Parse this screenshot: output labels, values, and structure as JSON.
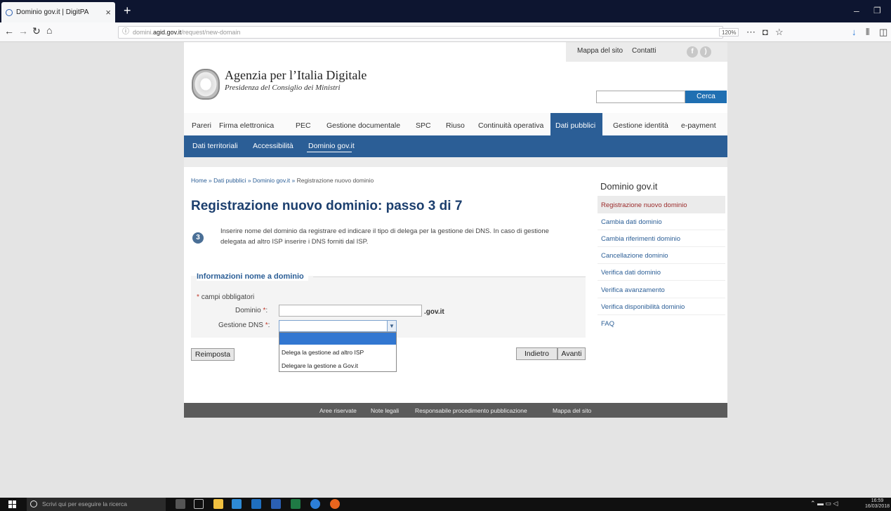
{
  "browser": {
    "tab_title": "Dominio gov.it | DigitPA",
    "url_prefix": "domini.",
    "url_host": "agid.gov.it",
    "url_path": "/request/new-domain",
    "zoom": "120%"
  },
  "header": {
    "sitemap": "Mappa del sito",
    "contacts": "Contatti",
    "agency": "Agenzia per l’Italia Digitale",
    "presidency": "Presidenza del Consiglio dei Ministri",
    "search_button": "Cerca"
  },
  "main_nav": [
    "Pareri",
    "Firma elettronica",
    "PEC",
    "Gestione documentale",
    "SPC",
    "Riuso",
    "Continuità operativa",
    "Dati pubblici",
    "Gestione identità",
    "e-payment"
  ],
  "sub_nav": [
    "Dati territoriali",
    "Accessibilità",
    "Dominio gov.it"
  ],
  "breadcrumb": {
    "home": "Home",
    "sep": " » ",
    "l1": "Dati pubblici",
    "l2": "Dominio gov.it",
    "current": "Registrazione nuovo dominio"
  },
  "page_title": "Registrazione nuovo dominio: passo 3 di 7",
  "step_number": "3",
  "description": "Inserire nome del dominio da registrare ed indicare il tipo di delega per la gestione dei DNS. In caso di gestione delegata ad altro ISP inserire i DNS forniti dal ISP.",
  "form": {
    "legend": "Informazioni nome a dominio",
    "required_note": "campi obbligatori",
    "domain_label": "Dominio",
    "domain_suffix": ".gov.it",
    "dns_label": "Gestione DNS",
    "required_mark": "*",
    "colon": ":",
    "dns_options": [
      "Delega la gestione ad altro ISP",
      "Delegare la gestione a Gov.it"
    ]
  },
  "buttons": {
    "reset": "Reimposta",
    "back": "Indietro",
    "next": "Avanti"
  },
  "sidebar": {
    "title": "Dominio gov.it",
    "items": [
      "Registrazione nuovo dominio",
      "Cambia dati dominio",
      "Cambia riferimenti dominio",
      "Cancellazione dominio",
      "Verifica dati dominio",
      "Verifica avanzamento",
      "Verifica disponibilità dominio",
      "FAQ"
    ]
  },
  "footer": [
    "Aree riservate",
    "Note legali",
    "Responsabile procedimento pubblicazione",
    "Mappa del sito"
  ],
  "taskbar": {
    "search_placeholder": "Scrivi qui per eseguire la ricerca",
    "time": "16:59",
    "date": "16/03/2018"
  }
}
